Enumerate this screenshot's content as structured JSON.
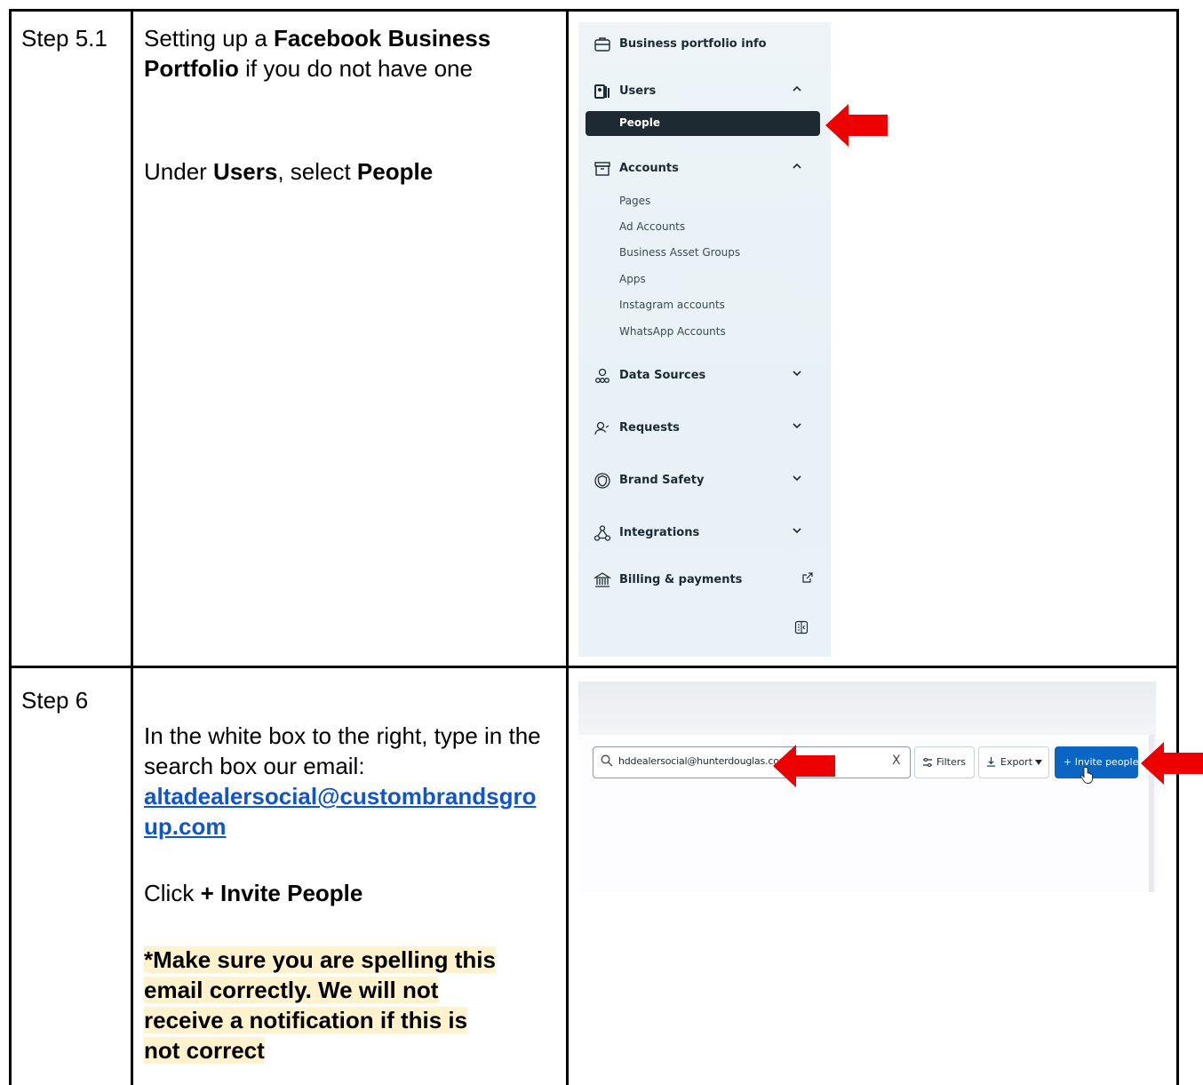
{
  "rows": [
    {
      "step": "Step 5.1",
      "intro_prefix": "Setting up a ",
      "intro_bold": "Facebook Business Portfolio",
      "intro_suffix": " if you do not have one",
      "instr_prefix": "Under ",
      "instr_bold1": "Users",
      "instr_mid": ", select ",
      "instr_bold2": "People"
    },
    {
      "step": "Step 6",
      "line1": "In the white box to the right, type in the search box our email:",
      "email": "altadealersocial@custombrandsgroup.com",
      "email_line1": "altadealersocial@custombrandsgro",
      "email_line2": "up.com",
      "click_prefix": "Click ",
      "click_bold": "+ Invite People",
      "warning_lines": [
        "*Make sure you are spelling this",
        "email correctly. We will not",
        "receive a notification if this is",
        "not correct"
      ]
    }
  ],
  "sidebar": {
    "business_info": "Business portfolio info",
    "users": "Users",
    "people": "People",
    "accounts": "Accounts",
    "account_items": [
      "Pages",
      "Ad Accounts",
      "Business Asset Groups",
      "Apps",
      "Instagram accounts",
      "WhatsApp Accounts"
    ],
    "data_sources": "Data Sources",
    "requests": "Requests",
    "brand_safety": "Brand Safety",
    "integrations": "Integrations",
    "billing": "Billing & payments"
  },
  "people_toolbar": {
    "search_value": "hddealersocial@hunterdouglas.com",
    "clear": "X",
    "filters": "Filters",
    "export": "Export",
    "invite": "+ Invite people"
  },
  "colors": {
    "arrow": "#ee0000",
    "active_item": "#1e2a32",
    "primary_button": "#0b66c3",
    "highlight": "#fff2cc",
    "link": "#1155cc"
  }
}
